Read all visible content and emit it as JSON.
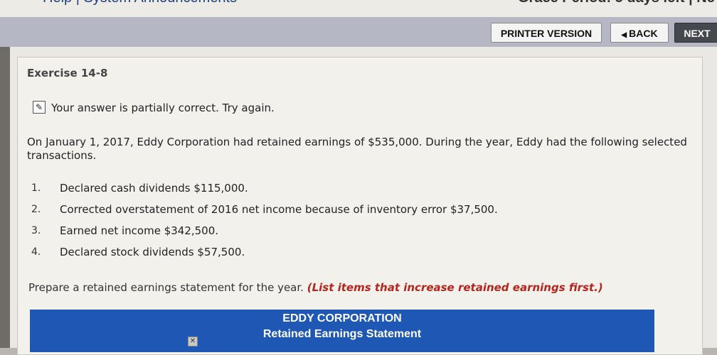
{
  "top": {
    "left_text": "Help | System Announcements",
    "right_text": "Grace Period: 5 days left | Ne"
  },
  "toolbar": {
    "printer_label": "PRINTER VERSION",
    "back_label": "BACK",
    "next_label": "NEXT"
  },
  "exercise": {
    "title": "Exercise 14-8",
    "status": "Your answer is partially correct.  Try again.",
    "intro": "On January 1, 2017, Eddy Corporation had retained earnings of $535,000. During the year, Eddy had the following selected transactions.",
    "items": [
      {
        "num": "1.",
        "text": "Declared cash dividends $115,000."
      },
      {
        "num": "2.",
        "text": "Corrected overstatement of 2016 net income because of inventory error $37,500."
      },
      {
        "num": "3.",
        "text": "Earned net income $342,500."
      },
      {
        "num": "4.",
        "text": "Declared stock dividends $57,500."
      }
    ],
    "instruction": "Prepare a retained earnings statement for the year.",
    "instruction_emphasis": "(List items that increase retained earnings first.)"
  },
  "statement": {
    "company": "EDDY CORPORATION",
    "title": "Retained Earnings Statement"
  },
  "icons": {
    "status": "pencil-check-icon",
    "back_arrow": "triangle-left-icon",
    "close": "close-icon"
  }
}
